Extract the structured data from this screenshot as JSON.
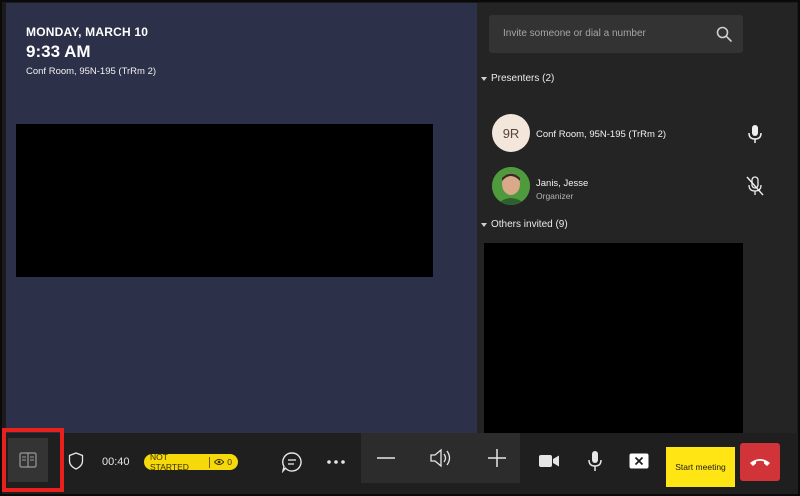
{
  "stage": {
    "date": "MONDAY, MARCH 10",
    "time": "9:33 AM",
    "room": "Conf Room, 95N-195 (TrRm 2)"
  },
  "panel": {
    "search_placeholder": "Invite someone or dial a number",
    "presenters_label": "Presenters (2)",
    "presenters": [
      {
        "initials": "9R",
        "name": "Conf Room, 95N-195 (TrRm 2)",
        "role": "",
        "mic": "mic-on"
      },
      {
        "initials": "",
        "name": "Janis, Jesse",
        "role": "Organizer",
        "mic": "mic-off"
      }
    ],
    "others_label": "Others invited (9)"
  },
  "toolbar": {
    "elapsed": "00:40",
    "status": "NOT STARTED",
    "viewers": "0",
    "start_label": "Start meeting"
  },
  "colors": {
    "stage_bg": "#2d3049",
    "accent_yellow": "#ffe514",
    "hangup_red": "#d13438",
    "highlight_red": "#e8211d"
  }
}
